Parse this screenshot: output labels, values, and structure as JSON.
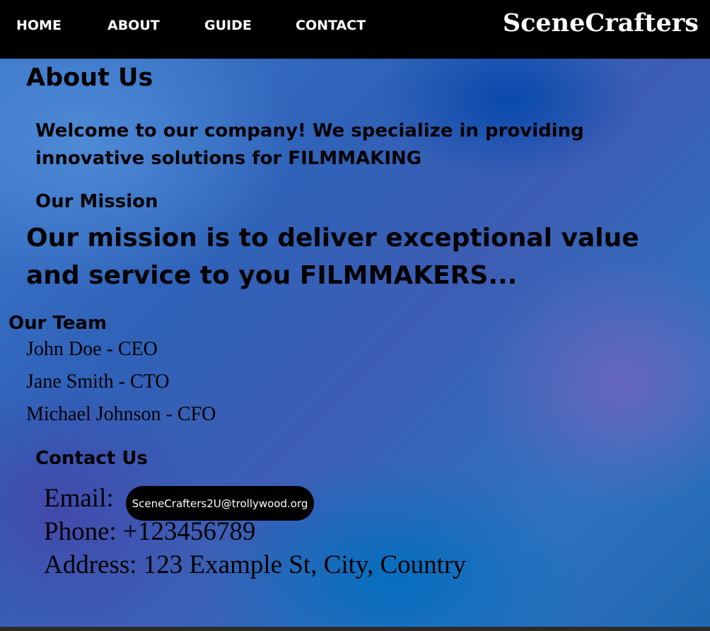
{
  "nav": {
    "links": [
      {
        "label": "HOME"
      },
      {
        "label": "ABOUT"
      },
      {
        "label": "GUIDE"
      },
      {
        "label": "CONTACT"
      }
    ],
    "brand": "SceneCrafters"
  },
  "about": {
    "title": "About Us",
    "welcome": "Welcome to our company! We specialize in providing innovative solutions for FILMMAKING"
  },
  "mission": {
    "heading": "Our Mission",
    "text": "Our mission is to deliver exceptional value and service to you FILMMAKERS..."
  },
  "team": {
    "heading": "Our Team",
    "members": [
      "John Doe - CEO",
      "Jane Smith - CTO",
      "Michael Johnson - CFO"
    ]
  },
  "contact": {
    "heading": "Contact Us",
    "email_label": "Email:",
    "email_value": "SceneCrafters2U@trollywood.org",
    "phone": "Phone: +123456789",
    "address": "Address: 123 Example St, City, Country"
  }
}
